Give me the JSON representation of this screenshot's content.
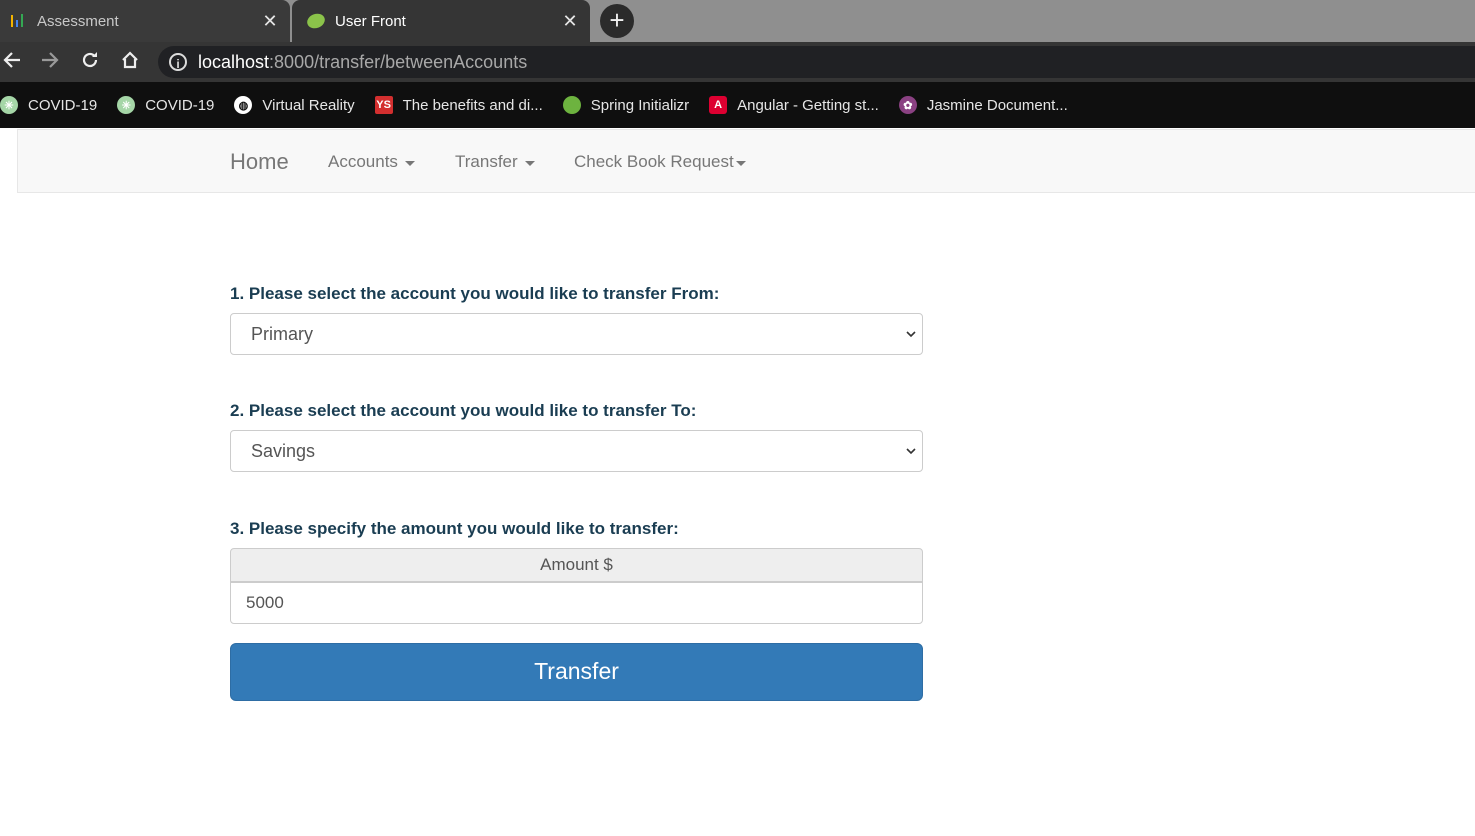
{
  "browser": {
    "tabs": [
      {
        "title": "Assessment",
        "icon": "bar-chart-icon",
        "close": "✕"
      },
      {
        "title": "User Front",
        "icon": "spring-leaf-icon",
        "close": "✕"
      }
    ],
    "new_tab": "+",
    "url_host": "localhost",
    "url_path": ":8000/transfer/betweenAccounts",
    "bookmarks": [
      {
        "label": "COVID-19",
        "icon": "globe-green-icon"
      },
      {
        "label": "COVID-19",
        "icon": "globe-green-icon"
      },
      {
        "label": "Virtual Reality",
        "icon": "globe-icon"
      },
      {
        "label": "The benefits and di...",
        "icon": "ys-icon"
      },
      {
        "label": "Spring Initializr",
        "icon": "spring-leaf-icon"
      },
      {
        "label": "Angular - Getting st...",
        "icon": "angular-icon"
      },
      {
        "label": "Jasmine Document...",
        "icon": "jasmine-icon"
      }
    ]
  },
  "navbar": {
    "brand": "Home",
    "items": [
      {
        "label": "Accounts"
      },
      {
        "label": "Transfer"
      },
      {
        "label": "Check Book Request"
      }
    ]
  },
  "form": {
    "from_label": "1. Please select the account you would like to transfer From:",
    "from_value": "Primary",
    "to_label": "2. Please select the account you would like to transfer To:",
    "to_value": "Savings",
    "amount_label": "3. Please specify the amount you would like to transfer:",
    "amount_addon": "Amount $",
    "amount_value": "5000",
    "submit_label": "Transfer"
  },
  "colors": {
    "primary_button": "#337ab7",
    "label_text": "#1a3d52",
    "navbar_bg": "#f8f8f8"
  }
}
